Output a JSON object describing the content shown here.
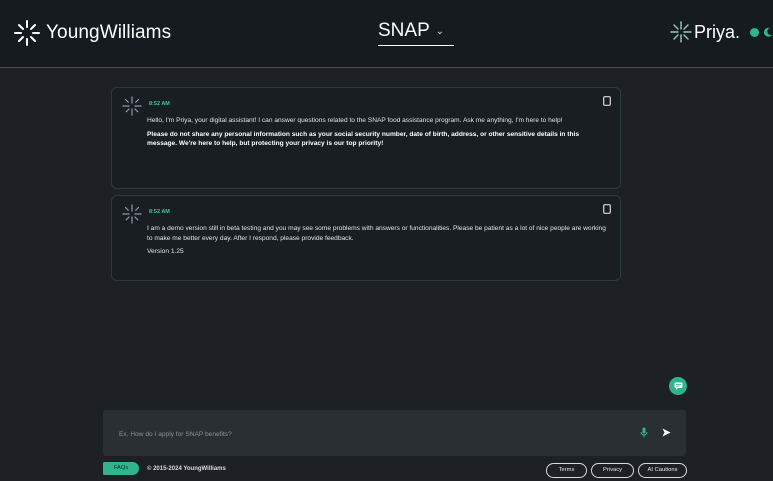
{
  "header": {
    "brand": "YoungWilliams",
    "program": "SNAP",
    "assistant": "Priya."
  },
  "messages": [
    {
      "time": "8:52 AM",
      "paragraphs": [
        "Hello, I'm Priya, your digital assistant! I can answer questions related to the SNAP food assistance program. Ask me anything, I'm here to help!"
      ],
      "warning": "Please do not share any personal information such as your social security number, date of birth, address, or other sensitive details in this message. We're here to help, but protecting your privacy is our top priority!"
    },
    {
      "time": "8:52 AM",
      "paragraphs": [
        "I am a demo version still in beta testing and you may see some problems with answers or functionalities. Please be patient as a lot of nice people are working to make me better every day. After I respond, please provide feedback.",
        "Version 1.25"
      ]
    }
  ],
  "composer": {
    "placeholder": "Ex. How do I apply for SNAP benefits?",
    "value": ""
  },
  "footer": {
    "faqs": "FAQs",
    "copyright": "© 2015-2024 YoungWilliams",
    "links": [
      "Terms",
      "Privacy",
      "AI Cautions"
    ]
  },
  "colors": {
    "accent": "#2fb58e",
    "background": "#1d2125",
    "header": "#161b1f"
  },
  "icons": [
    "youngwilliams-logo-icon",
    "chevron-down-icon",
    "priya-logo-icon",
    "globe-icon",
    "moon-icon",
    "copy-icon",
    "chat-icon",
    "microphone-icon",
    "send-icon"
  ]
}
